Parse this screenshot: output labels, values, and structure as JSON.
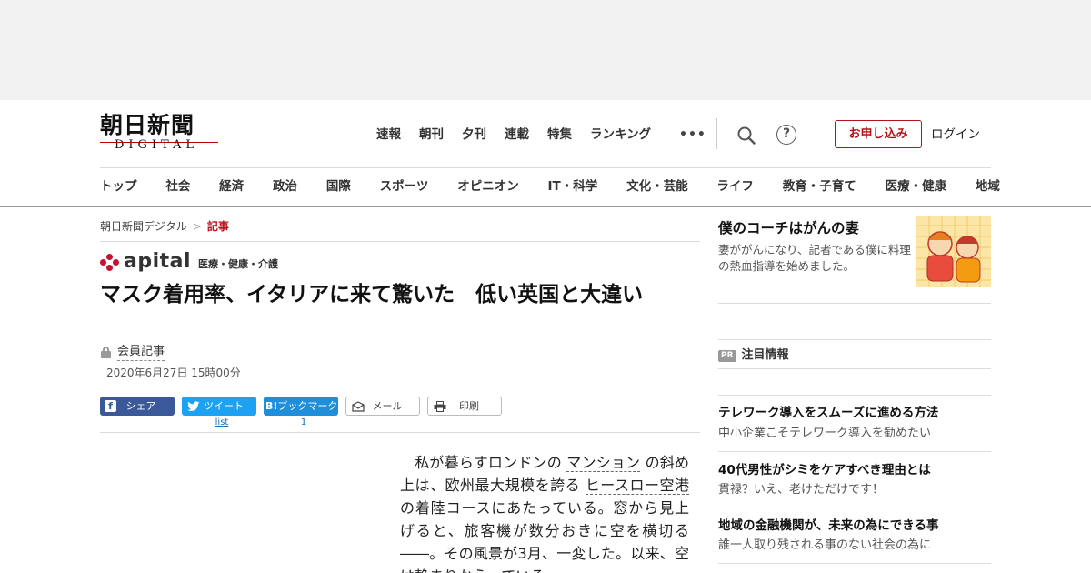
{
  "header": {
    "logo_main": "朝日新聞",
    "logo_sub": "DIGITAL",
    "nav": [
      "速報",
      "朝刊",
      "夕刊",
      "連載",
      "特集",
      "ランキング"
    ],
    "more": "•••",
    "help": "?",
    "subscribe": "お申し込み",
    "login": "ログイン"
  },
  "categories": [
    "トップ",
    "社会",
    "経済",
    "政治",
    "国際",
    "スポーツ",
    "オピニオン",
    "IT・科学",
    "文化・芸能",
    "ライフ",
    "教育・子育て",
    "医療・健康",
    "地域"
  ],
  "breadcrumb": {
    "home": "朝日新聞デジタル",
    "sep": ">",
    "current": "記事"
  },
  "section": {
    "name": "apital",
    "sub": "医療・健康・介護"
  },
  "article": {
    "headline": "マスク着用率、イタリアに来て驚いた　低い英国と大違い",
    "member_label": "会員記事",
    "date": "2020年6月27日 15時00分",
    "body": {
      "p1": "私が暮らすロンドンの",
      "kw1": "マンション",
      "p2": "の斜め上は、欧州最大規模を誇る",
      "kw2": "ヒースロー空港",
      "p3": "の着陸コースにあたっている。窓から見上げると、旅客機が数分おきに空を横切る――。その風景が3月、一変した。以来、空は静まりかえっている。"
    }
  },
  "share": {
    "facebook": "シェア",
    "twitter": "ツイート",
    "hatena_icon": "B!",
    "hatena": "ブックマーク",
    "mail": "メール",
    "print": "印刷",
    "twitter_count": "list",
    "hatena_count": "1"
  },
  "sidebar": {
    "promo": {
      "title": "僕のコーチはがんの妻",
      "desc": "妻ががんになり、記者である僕に料理の熱血指導を始めました。"
    },
    "pr_badge": "PR",
    "pr_title": "注目情報",
    "ads": [
      {
        "title": "テレワーク導入をスムーズに進める方法",
        "desc": "中小企業こそテレワーク導入を勧めたい"
      },
      {
        "title": "40代男性がシミをケアすべき理由とは",
        "desc": "貫禄？いえ、老けただけです！"
      },
      {
        "title": "地域の金融機関が、未来の為にできる事",
        "desc": "誰一人取り残される事のない社会の為に"
      }
    ]
  },
  "colors": {
    "brand_red": "#b5121b",
    "facebook": "#3b5998",
    "twitter": "#1da1f2",
    "hatena": "#1f8fdb"
  }
}
